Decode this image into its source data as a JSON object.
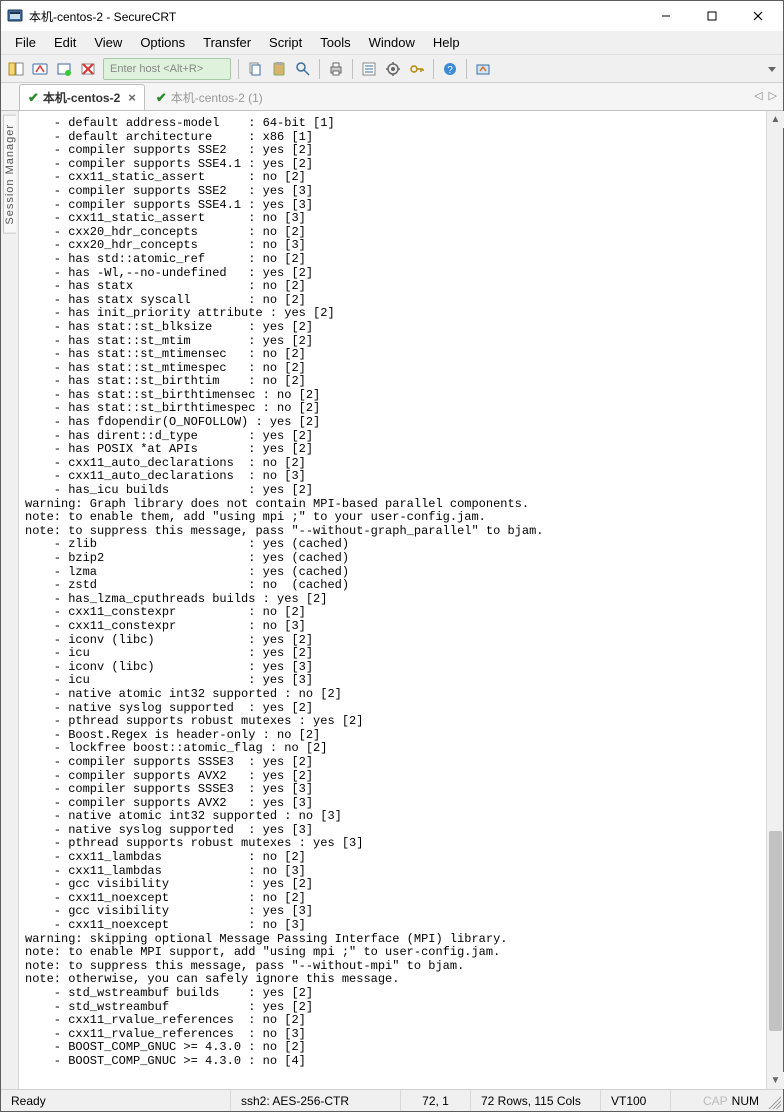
{
  "window": {
    "title": "本机-centos-2 - SecureCRT"
  },
  "menu": {
    "items": [
      "File",
      "Edit",
      "View",
      "Options",
      "Transfer",
      "Script",
      "Tools",
      "Window",
      "Help"
    ]
  },
  "toolbar": {
    "host_placeholder": "Enter host <Alt+R>"
  },
  "tabs": {
    "active": {
      "label": "本机-centos-2"
    },
    "inactive": {
      "label": "本机-centos-2 (1)"
    }
  },
  "side_panel": {
    "label": "Session Manager"
  },
  "status": {
    "ready": "Ready",
    "encryption": "ssh2: AES-256-CTR",
    "cursor": "72,  1",
    "dimensions": "72 Rows, 115 Cols",
    "term_type": "VT100",
    "cap": "CAP",
    "num": "NUM"
  },
  "terminal_lines": [
    "    - default address-model    : 64-bit [1]",
    "    - default architecture     : x86 [1]",
    "    - compiler supports SSE2   : yes [2]",
    "    - compiler supports SSE4.1 : yes [2]",
    "    - cxx11_static_assert      : no [2]",
    "    - compiler supports SSE2   : yes [3]",
    "    - compiler supports SSE4.1 : yes [3]",
    "    - cxx11_static_assert      : no [3]",
    "    - cxx20_hdr_concepts       : no [2]",
    "    - cxx20_hdr_concepts       : no [3]",
    "    - has std::atomic_ref      : no [2]",
    "    - has -Wl,--no-undefined   : yes [2]",
    "    - has statx                : no [2]",
    "    - has statx syscall        : no [2]",
    "    - has init_priority attribute : yes [2]",
    "    - has stat::st_blksize     : yes [2]",
    "    - has stat::st_mtim        : yes [2]",
    "    - has stat::st_mtimensec   : no [2]",
    "    - has stat::st_mtimespec   : no [2]",
    "    - has stat::st_birthtim    : no [2]",
    "    - has stat::st_birthtimensec : no [2]",
    "    - has stat::st_birthtimespec : no [2]",
    "    - has fdopendir(O_NOFOLLOW) : yes [2]",
    "    - has dirent::d_type       : yes [2]",
    "    - has POSIX *at APIs       : yes [2]",
    "    - cxx11_auto_declarations  : no [2]",
    "    - cxx11_auto_declarations  : no [3]",
    "    - has_icu builds           : yes [2]",
    "warning: Graph library does not contain MPI-based parallel components.",
    "note: to enable them, add \"using mpi ;\" to your user-config.jam.",
    "note: to suppress this message, pass \"--without-graph_parallel\" to bjam.",
    "    - zlib                     : yes (cached)",
    "    - bzip2                    : yes (cached)",
    "    - lzma                     : yes (cached)",
    "    - zstd                     : no  (cached)",
    "    - has_lzma_cputhreads builds : yes [2]",
    "    - cxx11_constexpr          : no [2]",
    "    - cxx11_constexpr          : no [3]",
    "    - iconv (libc)             : yes [2]",
    "    - icu                      : yes [2]",
    "    - iconv (libc)             : yes [3]",
    "    - icu                      : yes [3]",
    "    - native atomic int32 supported : no [2]",
    "    - native syslog supported  : yes [2]",
    "    - pthread supports robust mutexes : yes [2]",
    "    - Boost.Regex is header-only : no [2]",
    "    - lockfree boost::atomic_flag : no [2]",
    "    - compiler supports SSSE3  : yes [2]",
    "    - compiler supports AVX2   : yes [2]",
    "    - compiler supports SSSE3  : yes [3]",
    "    - compiler supports AVX2   : yes [3]",
    "    - native atomic int32 supported : no [3]",
    "    - native syslog supported  : yes [3]",
    "    - pthread supports robust mutexes : yes [3]",
    "    - cxx11_lambdas            : no [2]",
    "    - cxx11_lambdas            : no [3]",
    "    - gcc visibility           : yes [2]",
    "    - cxx11_noexcept           : no [2]",
    "    - gcc visibility           : yes [3]",
    "    - cxx11_noexcept           : no [3]",
    "warning: skipping optional Message Passing Interface (MPI) library.",
    "note: to enable MPI support, add \"using mpi ;\" to user-config.jam.",
    "note: to suppress this message, pass \"--without-mpi\" to bjam.",
    "note: otherwise, you can safely ignore this message.",
    "    - std_wstreambuf builds    : yes [2]",
    "    - std_wstreambuf           : yes [2]",
    "    - cxx11_rvalue_references  : no [2]",
    "    - cxx11_rvalue_references  : no [3]",
    "    - BOOST_COMP_GNUC >= 4.3.0 : no [2]",
    "    - BOOST_COMP_GNUC >= 4.3.0 : no [4]"
  ]
}
